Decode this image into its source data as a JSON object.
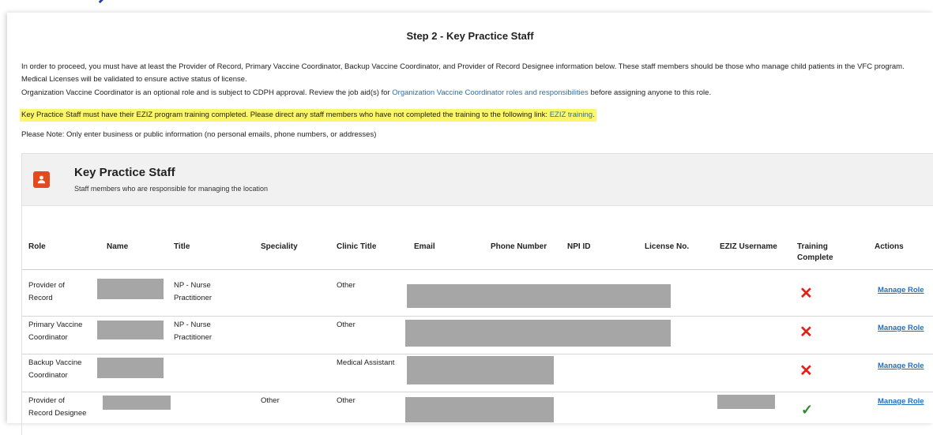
{
  "step_title": "Step 2 - Key Practice Staff",
  "instructions": {
    "para1": "In order to proceed, you must have at least the Provider of Record, Primary Vaccine Coordinator, Backup Vaccine Coordinator, and Provider of Record Designee information below. These staff members should be those who manage child patients in the VFC program. Medical Licenses will be validated to ensure active status of license.",
    "para2_before": "Organization Vaccine Coordinator is an optional role and is subject to CDPH approval. Review the job aid(s) for ",
    "para2_link": "Organization Vaccine Coordinator roles and responsibilities",
    "para2_after": " before assigning anyone to this role.",
    "para3_before": "Key Practice Staff must have their EZIZ program training completed. Please direct any staff members who have not completed the training to the following link: ",
    "para3_link": "EZIZ training",
    "para3_after": ".",
    "para4": "Please Note: Only enter business or public information (no personal emails, phone numbers, or addresses)"
  },
  "card": {
    "title": "Key Practice Staff",
    "subtitle": "Staff members who are responsible for managing the location",
    "icon": "person-icon"
  },
  "table": {
    "headers": {
      "role": "Role",
      "name": "Name",
      "title": "Title",
      "speciality": "Speciality",
      "clinic_title": "Clinic Title",
      "email": "Email",
      "phone": "Phone Number",
      "npi": "NPI ID",
      "license": "License No.",
      "eziz": "EZIZ Username",
      "training1": "Training",
      "training2": "Complete",
      "actions": "Actions"
    },
    "rows": [
      {
        "role1": "Provider of",
        "role2": "Record",
        "title1": "NP - Nurse",
        "title2": "Practitioner",
        "speciality": "",
        "clinic_title": "Other",
        "training_complete": false,
        "action": "Manage Role"
      },
      {
        "role1": "Primary Vaccine",
        "role2": "Coordinator",
        "title1": "NP - Nurse",
        "title2": "Practitioner",
        "speciality": "",
        "clinic_title": "Other",
        "training_complete": false,
        "action": "Manage Role"
      },
      {
        "role1": "Backup Vaccine",
        "role2": "Coordinator",
        "title1": "",
        "title2": "",
        "speciality": "",
        "clinic_title": "Medical Assistant",
        "training_complete": false,
        "action": "Manage Role"
      },
      {
        "role1": "Provider of",
        "role2": "Record Designee",
        "title1": "",
        "title2": "",
        "speciality": "Other",
        "clinic_title": "Other",
        "training_complete": true,
        "action": "Manage Role"
      }
    ]
  },
  "status_icons": {
    "incomplete": "✕",
    "complete": "✓"
  },
  "colors": {
    "accent": "#e04a1f",
    "highlight": "#fbf66a",
    "link": "#1f6fc2",
    "error": "#e0221b",
    "success": "#2e8b2e"
  }
}
